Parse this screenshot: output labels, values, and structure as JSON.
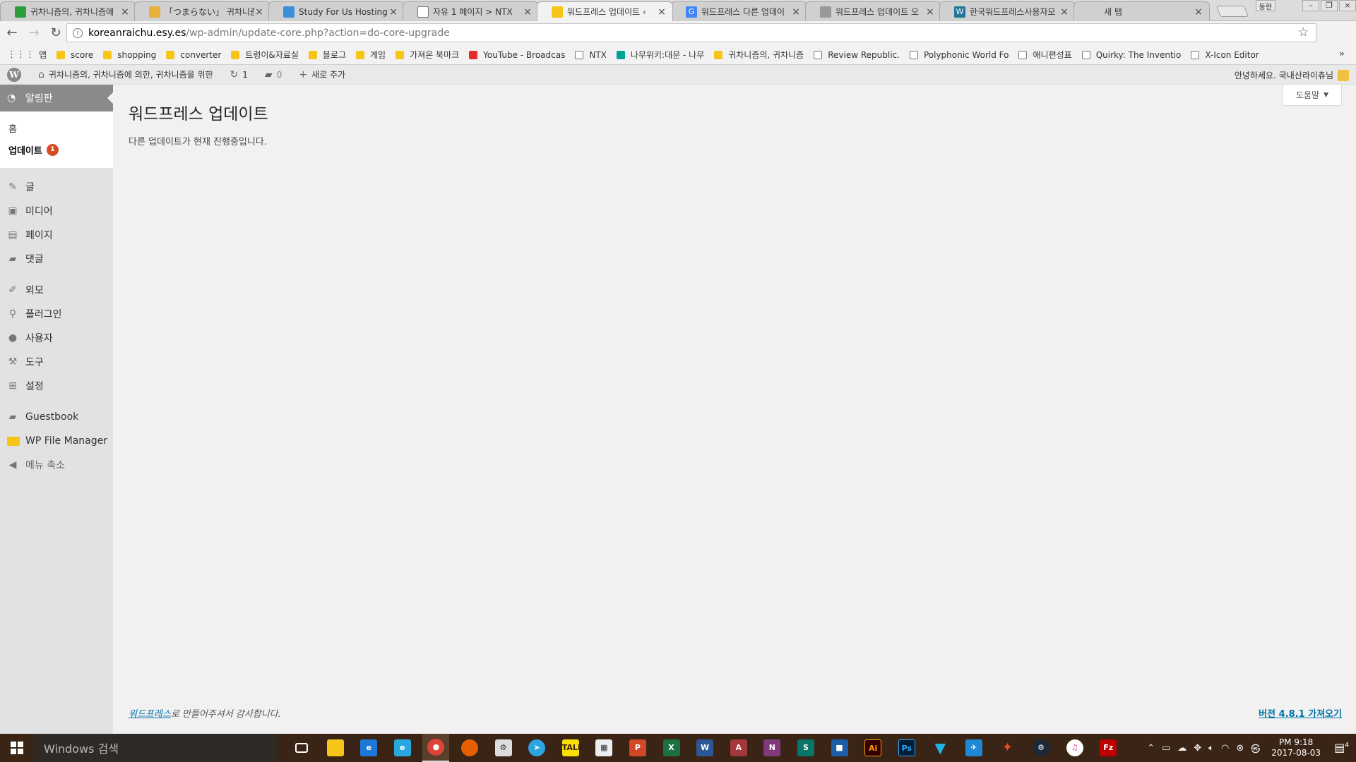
{
  "browser": {
    "tabs": [
      {
        "title": "귀차니즘의, 귀차니즘에",
        "favicon_color": "#2e9d3c",
        "active": false
      },
      {
        "title": "「つまらない」 귀차니즘",
        "favicon_color": "#e8b13a",
        "active": false
      },
      {
        "title": "Study For Us Hosting -",
        "favicon_color": "#3a8fd8",
        "active": false
      },
      {
        "title": "자유 1 페이지 > NTX",
        "favicon_color": "#ffffff",
        "active": false
      },
      {
        "title": "워드프레스 업데이트 ‹ ",
        "favicon_color": "#f5c518",
        "active": true
      },
      {
        "title": "워드프레스 다른 업데이",
        "favicon_color": "#4285f4",
        "active": false
      },
      {
        "title": "워드프레스 업데이트 오",
        "favicon_color": "#999999",
        "active": false
      },
      {
        "title": "한국워드프레스사용자모",
        "favicon_color": "#21759b",
        "active": false
      },
      {
        "title": "새 탭",
        "favicon_color": "#ffffff",
        "active": false
      }
    ],
    "profile_badge": "동현",
    "url_host": "koreanraichu.esy.es",
    "url_path": "/wp-admin/update-core.php?action=do-core-upgrade"
  },
  "bookmarks": {
    "apps_label": "앱",
    "items": [
      {
        "label": "score",
        "type": "folder"
      },
      {
        "label": "shopping",
        "type": "folder"
      },
      {
        "label": "converter",
        "type": "folder"
      },
      {
        "label": "트렁이&자료실",
        "type": "folder"
      },
      {
        "label": "블로그",
        "type": "folder"
      },
      {
        "label": "게임",
        "type": "folder"
      },
      {
        "label": "가져온 북마크",
        "type": "folder"
      },
      {
        "label": "YouTube - Broadcas",
        "type": "yt"
      },
      {
        "label": "NTX",
        "type": "page"
      },
      {
        "label": "나무위키:대문 - 나무",
        "type": "green"
      },
      {
        "label": "귀차니즘의, 귀차니즘",
        "type": "folder"
      },
      {
        "label": "Review Republic.",
        "type": "page"
      },
      {
        "label": "Polyphonic World Fo",
        "type": "page"
      },
      {
        "label": "애니편성표",
        "type": "page"
      },
      {
        "label": "Quirky: The Inventio",
        "type": "page"
      },
      {
        "label": "X-Icon Editor",
        "type": "page"
      }
    ]
  },
  "adminbar": {
    "site_name": "귀차니즘의, 귀차니즘에 의한, 귀차니즘을 위한",
    "updates_count": "1",
    "comments_count": "0",
    "new_label": "새로 추가",
    "greeting": "안녕하세요. 국내산라이츄님"
  },
  "sidebar": {
    "dashboard_label": "알림판",
    "home_label": "홈",
    "updates_label": "업데이트",
    "updates_badge": "1",
    "items": [
      {
        "label": "글",
        "icon": "pin-icon"
      },
      {
        "label": "미디어",
        "icon": "media-icon"
      },
      {
        "label": "페이지",
        "icon": "pages-icon"
      },
      {
        "label": "댓글",
        "icon": "comments-icon"
      },
      {
        "label": "외모",
        "icon": "appearance-icon"
      },
      {
        "label": "플러그인",
        "icon": "plugins-icon"
      },
      {
        "label": "사용자",
        "icon": "users-icon"
      },
      {
        "label": "도구",
        "icon": "tools-icon"
      },
      {
        "label": "설정",
        "icon": "settings-icon"
      },
      {
        "label": "Guestbook",
        "icon": "guestbook-icon"
      },
      {
        "label": "WP File Manager",
        "icon": "folder-icon"
      },
      {
        "label": "메뉴 축소",
        "icon": "collapse-icon"
      }
    ]
  },
  "main": {
    "help_label": "도움말",
    "page_title": "워드프레스 업데이트",
    "notice": "다른 업데이트가 현재 진행중입니다.",
    "footer_link": "워드프레스",
    "footer_text": "로 만들어주셔서 감사합니다.",
    "version_link": "버전 4.8.1 가져오기"
  },
  "taskbar": {
    "search_placeholder": "Windows 검색",
    "time": "PM 9:18",
    "date": "2017-08-03",
    "notif_count": "4"
  }
}
